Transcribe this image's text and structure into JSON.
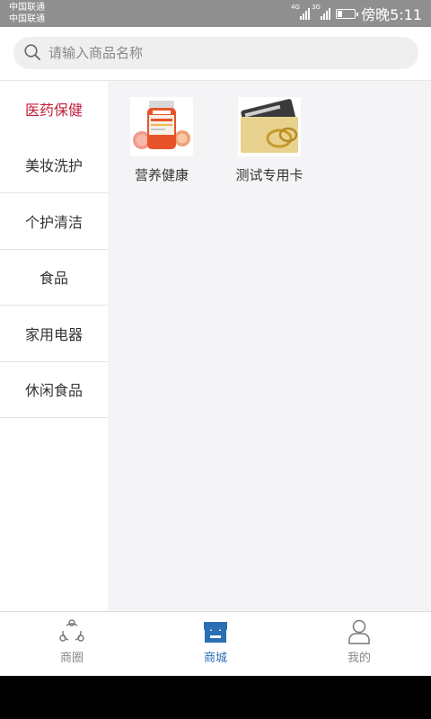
{
  "status_bar": {
    "carrier_1": "中国联通",
    "carrier_2": "中国联通",
    "network_1": "4G",
    "network_2": "3G",
    "time": "傍晚5:11",
    "battery_level": 0.3
  },
  "search": {
    "placeholder": "请输入商品名称"
  },
  "categories": [
    {
      "label": "医药保健",
      "active": true
    },
    {
      "label": "美妆洗护",
      "active": false
    },
    {
      "label": "个护清洁",
      "active": false
    },
    {
      "label": "食品",
      "active": false
    },
    {
      "label": "家用电器",
      "active": false
    },
    {
      "label": "休闲食品",
      "active": false
    }
  ],
  "products": [
    {
      "name": "营养健康",
      "image": "swisse-vitamin-bottle"
    },
    {
      "name": "测试专用卡",
      "image": "gold-rings-card"
    }
  ],
  "tabs": [
    {
      "label": "商圈",
      "icon": "share-circle-icon",
      "active": false
    },
    {
      "label": "商城",
      "icon": "store-icon",
      "active": true
    },
    {
      "label": "我的",
      "icon": "user-icon",
      "active": false
    }
  ],
  "colors": {
    "accent_red": "#c31e3a",
    "accent_blue": "#2a6fb4",
    "status_bar": "#8f8f8f"
  }
}
